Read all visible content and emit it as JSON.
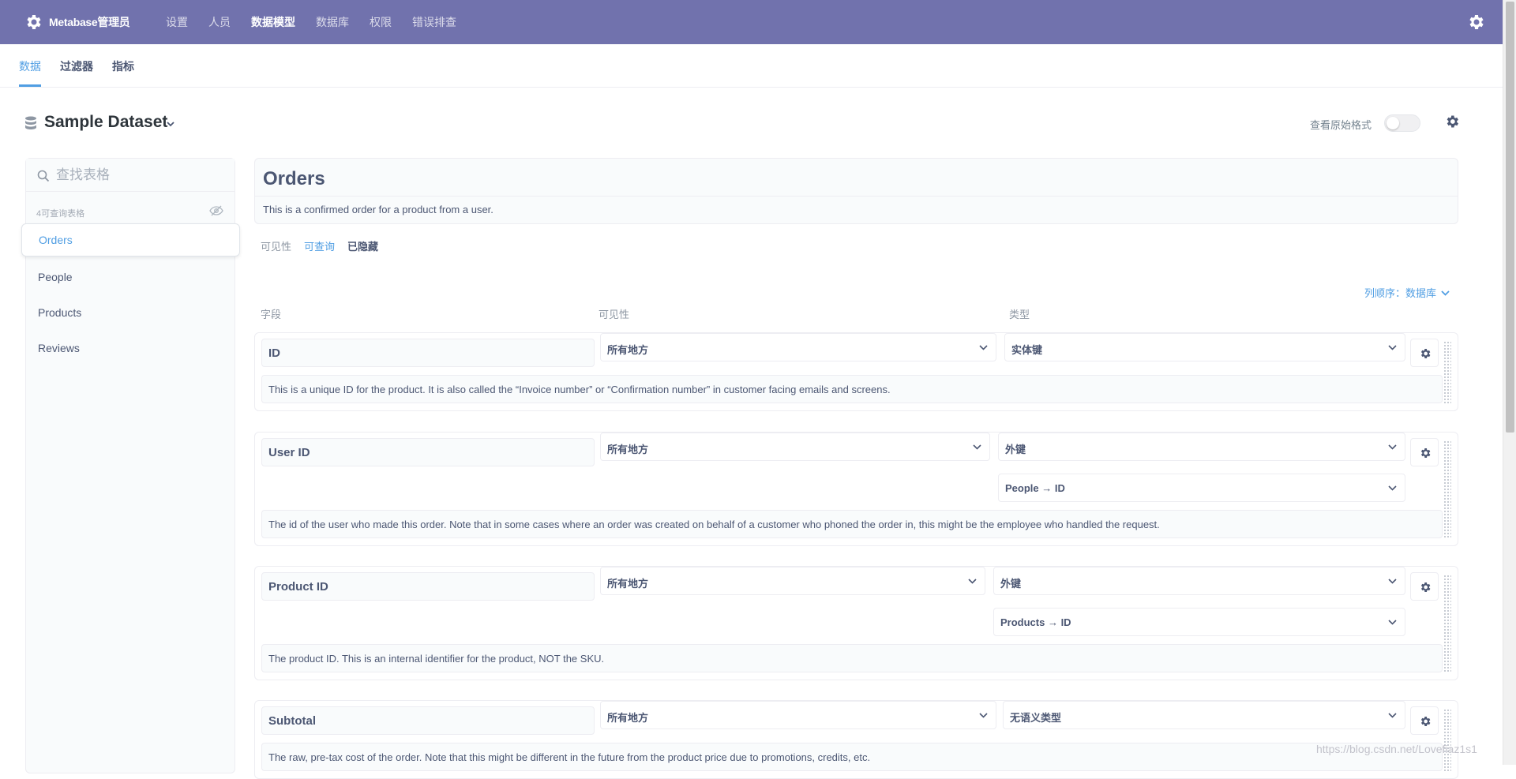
{
  "topnav": {
    "brand": "Metabase管理员",
    "tabs": [
      {
        "label": "设置"
      },
      {
        "label": "人员"
      },
      {
        "label": "数据模型"
      },
      {
        "label": "数据库"
      },
      {
        "label": "权限"
      },
      {
        "label": "错误排查"
      }
    ],
    "active_tab": "数据模型",
    "background": "#7172ad"
  },
  "subnav": {
    "tabs": [
      {
        "label": "数据"
      },
      {
        "label": "过滤器"
      },
      {
        "label": "指标"
      }
    ],
    "active_tab": "数据"
  },
  "dataset": {
    "title": "Sample Dataset",
    "raw_label": "查看原始格式",
    "raw_toggle_on": false
  },
  "sidebar": {
    "search_placeholder": "查找表格",
    "queryable_count": "4可查询表格",
    "tables": [
      {
        "label": "Orders"
      },
      {
        "label": "People"
      },
      {
        "label": "Products"
      },
      {
        "label": "Reviews"
      }
    ],
    "active_table": "Orders"
  },
  "table": {
    "name": "Orders",
    "description": "This is a confirmed order for a product from a user.",
    "visibility_label": "可见性",
    "visibility_options": [
      {
        "label": "可查询"
      },
      {
        "label": "已隐藏"
      }
    ],
    "visibility_selected": "可查询",
    "column_order": "列顺序：数据库"
  },
  "columns_header": {
    "field": "字段",
    "visibility": "可见性",
    "type": "类型"
  },
  "fields": [
    {
      "name": "ID",
      "visibility": "所有地方",
      "type": "实体键",
      "target": null,
      "description": "This is a unique ID for the product. It is also called the “Invoice number” or “Confirmation number” in customer facing emails and screens."
    },
    {
      "name": "User ID",
      "visibility": "所有地方",
      "type": "外键",
      "target": "People → ID",
      "description": "The id of the user who made this order. Note that in some cases where an order was created on behalf of a customer who phoned the order in, this might be the employee who handled the request."
    },
    {
      "name": "Product ID",
      "visibility": "所有地方",
      "type": "外键",
      "target": "Products → ID",
      "description": "The product ID. This is an internal identifier for the product, NOT the SKU."
    },
    {
      "name": "Subtotal",
      "visibility": "所有地方",
      "type": "无语义类型",
      "target": null,
      "description": "The raw, pre-tax cost of the order. Note that this might be different in the future from the product price due to promotions, credits, etc."
    }
  ],
  "watermark": "https://blog.csdn.net/Lovefiaz1s1",
  "colors": {
    "accent": "#509ee3",
    "text": "#4c5773",
    "border": "#ededf2"
  }
}
